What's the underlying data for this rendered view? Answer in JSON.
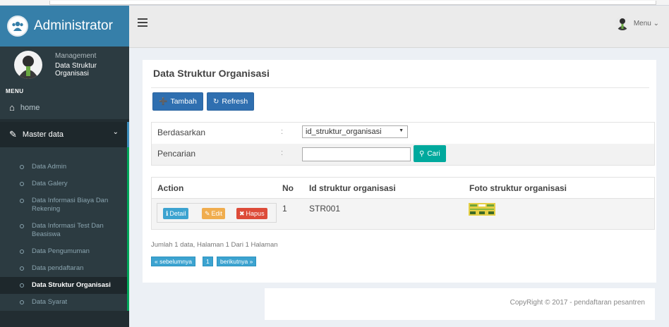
{
  "sidebar": {
    "brand_title": "Administrator",
    "user_role": "Management",
    "user_page": "Data Struktur Organisasi",
    "menu_header": "MENU",
    "home_label": "home",
    "master_label": "Master data",
    "items": [
      {
        "label": "Data Admin"
      },
      {
        "label": "Data Galery"
      },
      {
        "label": "Data Informasi Biaya Dan Rekening"
      },
      {
        "label": "Data Informasi Test Dan Beasiswa"
      },
      {
        "label": "Data Pengumuman"
      },
      {
        "label": "Data pendaftaran"
      },
      {
        "label": "Data Struktur Organisasi"
      },
      {
        "label": "Data Syarat"
      }
    ]
  },
  "navbar": {
    "menu_label": "Menu ⌄"
  },
  "main": {
    "title": "Data Struktur Organisasi",
    "add_label": "Tambah",
    "refresh_label": "Refresh",
    "filter": {
      "by_label": "Berdasarkan",
      "colon": ":",
      "by_value": "id_struktur_organisasi",
      "search_label": "Pencarian",
      "search_value": "",
      "search_button": "Cari"
    },
    "table": {
      "headers": [
        "Action",
        "No",
        "Id struktur organisasi",
        "Foto struktur organisasi"
      ],
      "rows": [
        {
          "no": "1",
          "id": "STR001",
          "detail": "Detail",
          "edit": "Edit",
          "delete": "Hapus"
        }
      ]
    },
    "summary": "Jumlah 1 data, Halaman 1 Dari 1 Halaman",
    "pagination": {
      "prev": "« sebelumnya",
      "page": "1",
      "next": "berikutnya »"
    }
  },
  "footer": {
    "text": "CopyRight © 2017 - pendaftaran pesantren"
  },
  "colors": {
    "sidebar_bg": "#222d32",
    "brand_bg": "#367fa9",
    "primary": "#2f6fb0",
    "success": "#00a99d",
    "info": "#3ca3d0",
    "warning": "#f0ad4e",
    "danger": "#dd4b39"
  }
}
